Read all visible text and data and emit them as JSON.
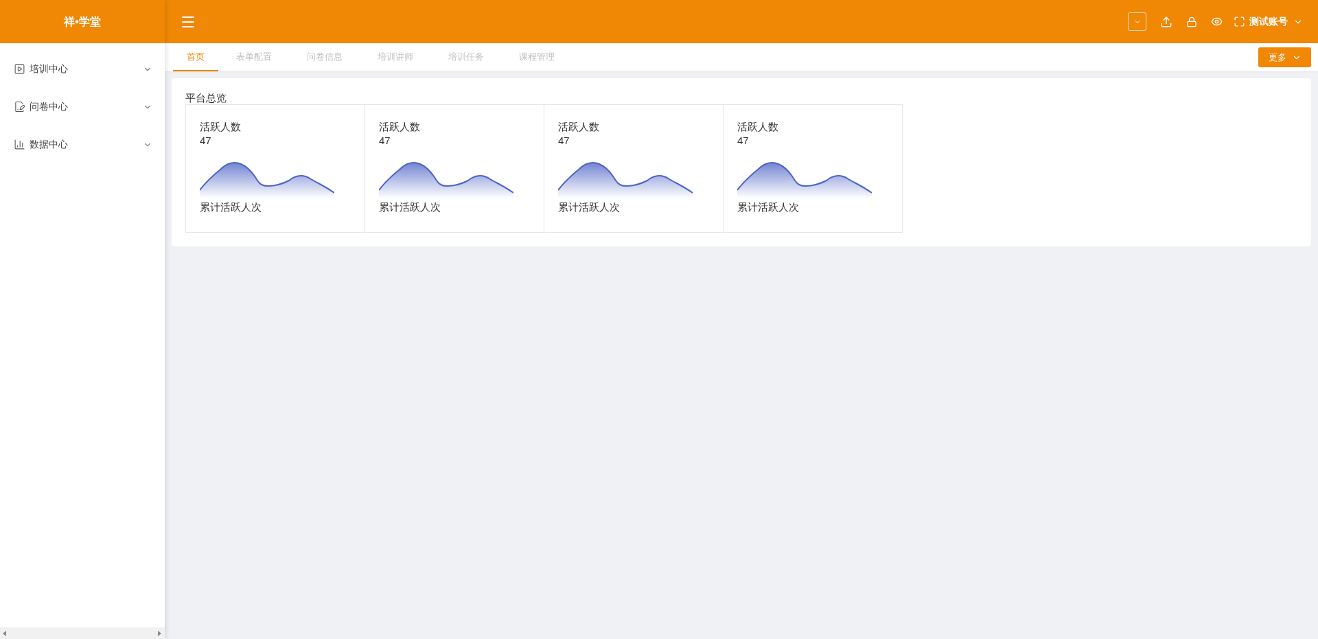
{
  "logo": "祥•学堂",
  "sidebar": {
    "items": [
      {
        "label": "培训中心"
      },
      {
        "label": "问卷中心"
      },
      {
        "label": "数据中心"
      }
    ]
  },
  "header": {
    "user": "测试账号"
  },
  "tabs": [
    {
      "label": "首页",
      "selected": true
    },
    {
      "label": "表单配置",
      "selected": false
    },
    {
      "label": "问卷信息",
      "selected": false
    },
    {
      "label": "培训讲师",
      "selected": false
    },
    {
      "label": "培训任务",
      "selected": false
    },
    {
      "label": "课程管理",
      "selected": false
    }
  ],
  "more_button": "更多",
  "overview": {
    "title": "平台总览",
    "cards": [
      {
        "title": "活跃人数",
        "value": "47",
        "caption": "累计活跃人次"
      },
      {
        "title": "活跃人数",
        "value": "47",
        "caption": "累计活跃人次"
      },
      {
        "title": "活跃人数",
        "value": "47",
        "caption": "累计活跃人次"
      },
      {
        "title": "活跃人数",
        "value": "47",
        "caption": "累计活跃人次"
      }
    ]
  }
}
